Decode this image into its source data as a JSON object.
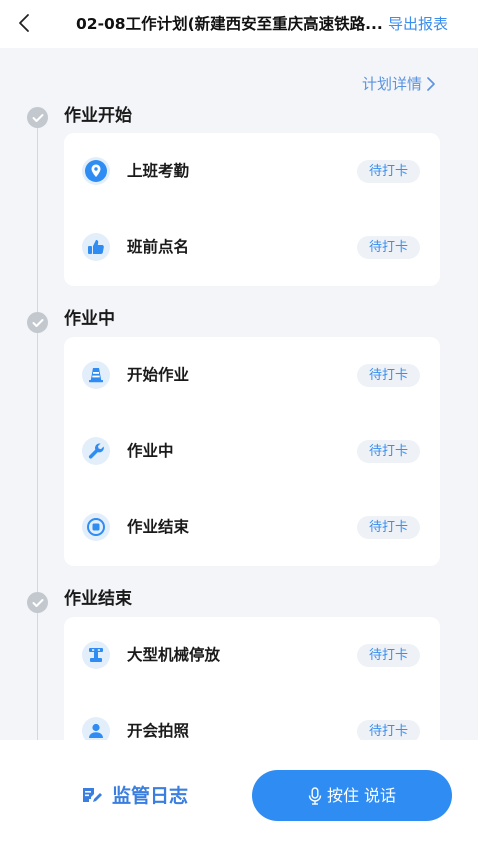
{
  "header": {
    "title": "02-08工作计划(新建西安至重庆高速铁路...",
    "export_label": "导出报表"
  },
  "plan_detail_label": "计划详情",
  "sections": [
    {
      "title": "作业开始",
      "items": [
        {
          "label": "上班考勤",
          "status": "待打卡",
          "icon": "location-pin-icon"
        },
        {
          "label": "班前点名",
          "status": "待打卡",
          "icon": "thumbs-up-icon"
        }
      ]
    },
    {
      "title": "作业中",
      "items": [
        {
          "label": "开始作业",
          "status": "待打卡",
          "icon": "traffic-cone-icon"
        },
        {
          "label": "作业中",
          "status": "待打卡",
          "icon": "wrench-icon"
        },
        {
          "label": "作业结束",
          "status": "待打卡",
          "icon": "stop-circle-icon"
        }
      ]
    },
    {
      "title": "作业结束",
      "items": [
        {
          "label": "大型机械停放",
          "status": "待打卡",
          "icon": "machinery-icon"
        },
        {
          "label": "开会拍照",
          "status": "待打卡",
          "icon": "person-icon"
        }
      ]
    }
  ],
  "bottom": {
    "log_label": "监管日志",
    "voice_label": "按住 说话"
  },
  "colors": {
    "accent": "#2f8cf2",
    "link": "#3a8ef0",
    "background": "#f3f5f8"
  }
}
